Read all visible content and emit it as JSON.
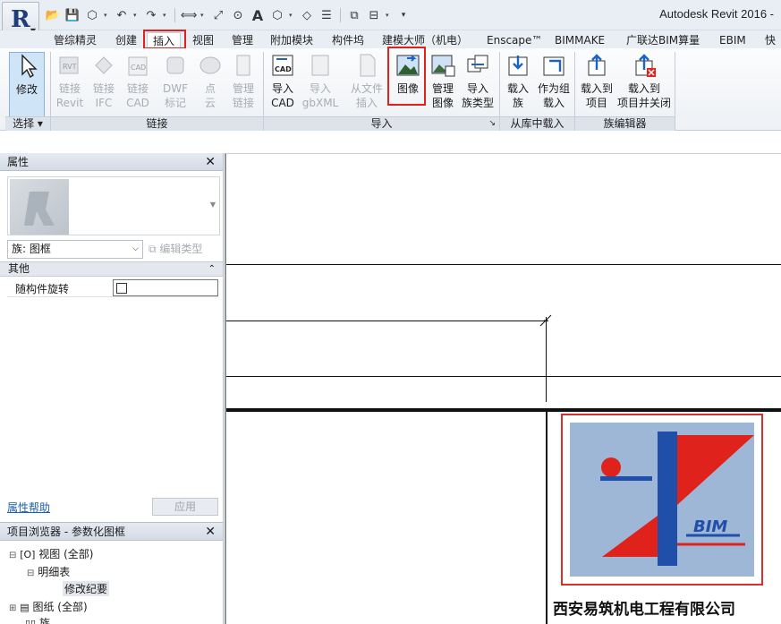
{
  "app": {
    "title": "Autodesk Revit 2016 -",
    "logo_letter": "R",
    "qat_icons": [
      "open-icon",
      "save-icon",
      "sync-icon",
      "undo-icon",
      "redo-icon",
      "measure-icon",
      "dimension-icon",
      "tag-icon",
      "text-icon",
      "3d-view-icon",
      "section-icon",
      "thin-lines-icon",
      "close-hidden-icon",
      "switch-windows-icon",
      "customize-icon"
    ]
  },
  "tabs": [
    "管综精灵",
    "创建",
    "插入",
    "视图",
    "管理",
    "附加模块",
    "构件坞",
    "建模大师（机电）",
    "Enscape™",
    "BIMMAKE",
    "广联达BIM算量",
    "EBIM",
    "快"
  ],
  "ribbon": {
    "modify": {
      "label": "修改"
    },
    "select_panel": "选择",
    "link_buttons": [
      {
        "l1": "链接",
        "l2": "Revit"
      },
      {
        "l1": "链接",
        "l2": "IFC"
      },
      {
        "l1": "链接",
        "l2": "CAD"
      },
      {
        "l1": "DWF",
        "l2": "标记"
      },
      {
        "l1": "点",
        "l2": "云"
      },
      {
        "l1": "管理",
        "l2": "链接"
      }
    ],
    "link_panel": "链接",
    "import_buttons": [
      {
        "l1": "导入",
        "l2": "CAD"
      },
      {
        "l1": "导入",
        "l2": "gbXML"
      },
      {
        "l1": "从文件",
        "l2": "插入"
      },
      {
        "l1": "图像",
        "l2": ""
      },
      {
        "l1": "管理",
        "l2": "图像"
      },
      {
        "l1": "导入",
        "l2": "族类型"
      }
    ],
    "import_panel": "导入",
    "library_buttons": [
      {
        "l1": "载入",
        "l2": "族"
      },
      {
        "l1": "作为组",
        "l2": "载入"
      }
    ],
    "library_panel": "从库中载入",
    "family_buttons": [
      {
        "l1": "载入到",
        "l2": "项目"
      },
      {
        "l1": "载入到",
        "l2": "项目并关闭"
      }
    ],
    "family_panel": "族编辑器",
    "cad_icon_text": "CAD"
  },
  "properties": {
    "title": "属性",
    "family": "族: 图框",
    "edit_type": "编辑类型",
    "group": "其他",
    "param_label": "随构件旋转",
    "help_link": "属性帮助",
    "apply": "应用"
  },
  "browser": {
    "title": "项目浏览器 - 参数化图框",
    "items": [
      "视图 (全部)",
      "明细表",
      "修改纪要",
      "图纸 (全部)",
      "族"
    ]
  },
  "canvas": {
    "logo_text": "BIM",
    "caption": "西安易筑机电工程有限公司"
  }
}
